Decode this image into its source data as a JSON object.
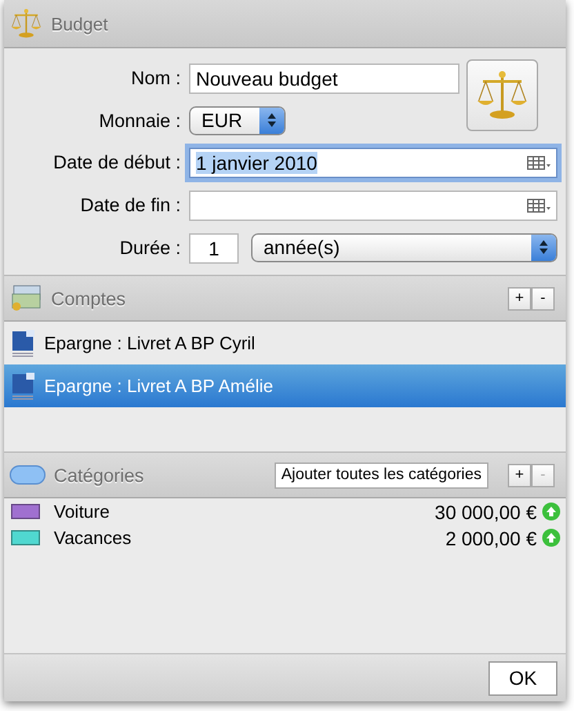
{
  "window": {
    "title": "Budget"
  },
  "form": {
    "fields": [
      {
        "kind": "text",
        "label": "Nom :",
        "value": "Nouveau budget",
        "focused": false
      },
      {
        "kind": "popup",
        "label": "Monnaie :",
        "value": "EUR",
        "focused": false
      },
      {
        "kind": "date",
        "label": "Date de début :",
        "value": "1 janvier 2010",
        "focused": true
      },
      {
        "kind": "date",
        "label": "Date de fin :",
        "focused": false
      },
      {
        "kind": "duration",
        "label": "Durée :",
        "value": "1",
        "unit": "année(s)",
        "focused": false
      }
    ]
  },
  "accounts": {
    "title": "Comptes",
    "add": {
      "label": "+",
      "disabled": false
    },
    "remove": {
      "label": "-",
      "disabled": false
    },
    "items": [
      {
        "label": "Epargne : Livret A BP Cyril",
        "selected": false
      },
      {
        "label": "Epargne : Livret A BP Amélie",
        "selected": true
      }
    ]
  },
  "categories": {
    "title": "Catégories",
    "add_all": "Ajouter toutes les catégories",
    "add": {
      "label": "+",
      "disabled": false
    },
    "remove": {
      "label": "-",
      "disabled": true
    },
    "items": [
      {
        "name": "Voiture",
        "color": "#a070d0",
        "amount": "30 000,00 €"
      },
      {
        "name": "Vacances",
        "color": "#50d8d0",
        "amount": "2 000,00 €"
      }
    ]
  },
  "ok": "OK"
}
